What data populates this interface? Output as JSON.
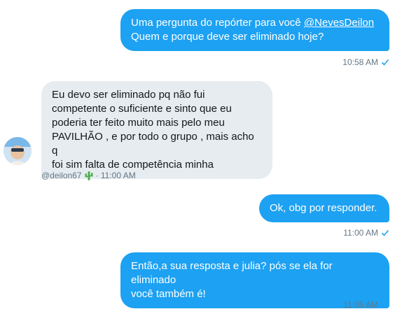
{
  "messages": [
    {
      "text_prefix": "Uma pergunta do repórter para você ",
      "mention": "@NevesDeilon",
      "text_suffix": "Quem e porque deve ser eliminado hoje?",
      "time": "10:58 AM"
    },
    {
      "lines": [
        "Eu devo ser eliminado pq não fui",
        "competente o suficiente e sinto que eu",
        "poderia ter feito muito mais pelo meu",
        "PAVILHÃO , e por todo o grupo , mais acho q",
        "foi sim falta de competência minha"
      ],
      "username": "@deilon67",
      "time": "· 11:00 AM"
    },
    {
      "text": "Ok, obg por responder.",
      "time": "11:00 AM"
    },
    {
      "line1": "Então,a sua resposta e julia? pós se ela for eliminado",
      "line2": "você também é!",
      "time": "11:05 AM"
    }
  ],
  "colors": {
    "outgoing_bubble": "#1da1f2",
    "incoming_bubble": "#e6ecf0",
    "meta_text": "#657786",
    "cactus": "#4caf50"
  },
  "icons": {
    "read_receipt": "check-icon",
    "emoji": "cactus-emoji-icon"
  }
}
